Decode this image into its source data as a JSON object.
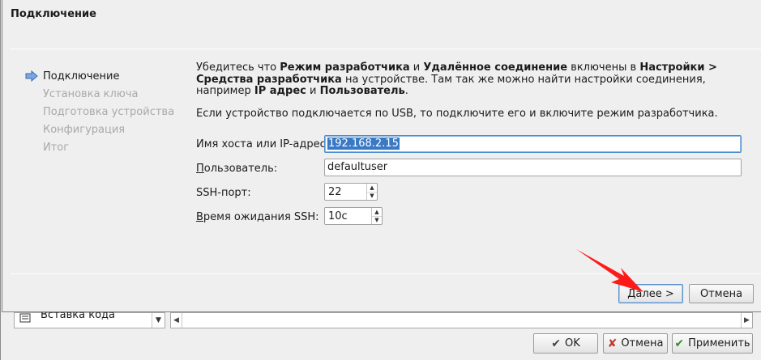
{
  "dialog": {
    "title": "Подключение",
    "steps": [
      {
        "label": "Подключение",
        "active": true
      },
      {
        "label": "Установка ключа",
        "active": false
      },
      {
        "label": "Подготовка устройства",
        "active": false
      },
      {
        "label": "Конфигурация",
        "active": false
      },
      {
        "label": "Итог",
        "active": false
      }
    ],
    "info": {
      "p1_a": "Убедитесь что ",
      "p1_b": "Режим разработчика",
      "p1_c": " и ",
      "p1_d": "Удалённое соединение",
      "p1_e": " включены в ",
      "p1_f": "Настройки > Средства разработчика",
      "p1_g": " на устройстве. Там так же можно найти настройки соединения, например ",
      "p1_h": "IP адрес",
      "p1_i": " и ",
      "p1_j": "Пользователь",
      "p1_k": ".",
      "p2": "Если устройство подключается по USB, то подключите его и включите режим разработчика."
    },
    "form": {
      "host_label": "Имя хоста или IP-адрес:",
      "host_value": "192.168.2.15",
      "user_label_u": "П",
      "user_label_rest": "ользователь:",
      "user_value": "defaultuser",
      "ssh_port_label": "SSH-порт:",
      "ssh_port_value": "22",
      "ssh_timeout_label_u": "В",
      "ssh_timeout_label_rest": "ремя ожидания SSH:",
      "ssh_timeout_value": "10с"
    },
    "buttons": {
      "next_u": "Д",
      "next_rest": "алее >",
      "cancel": "Отмена"
    }
  },
  "background": {
    "combo_text": "Вставка кода",
    "ok_label": "OK",
    "cancel_label": "Отмена",
    "apply_label": "Применить"
  }
}
